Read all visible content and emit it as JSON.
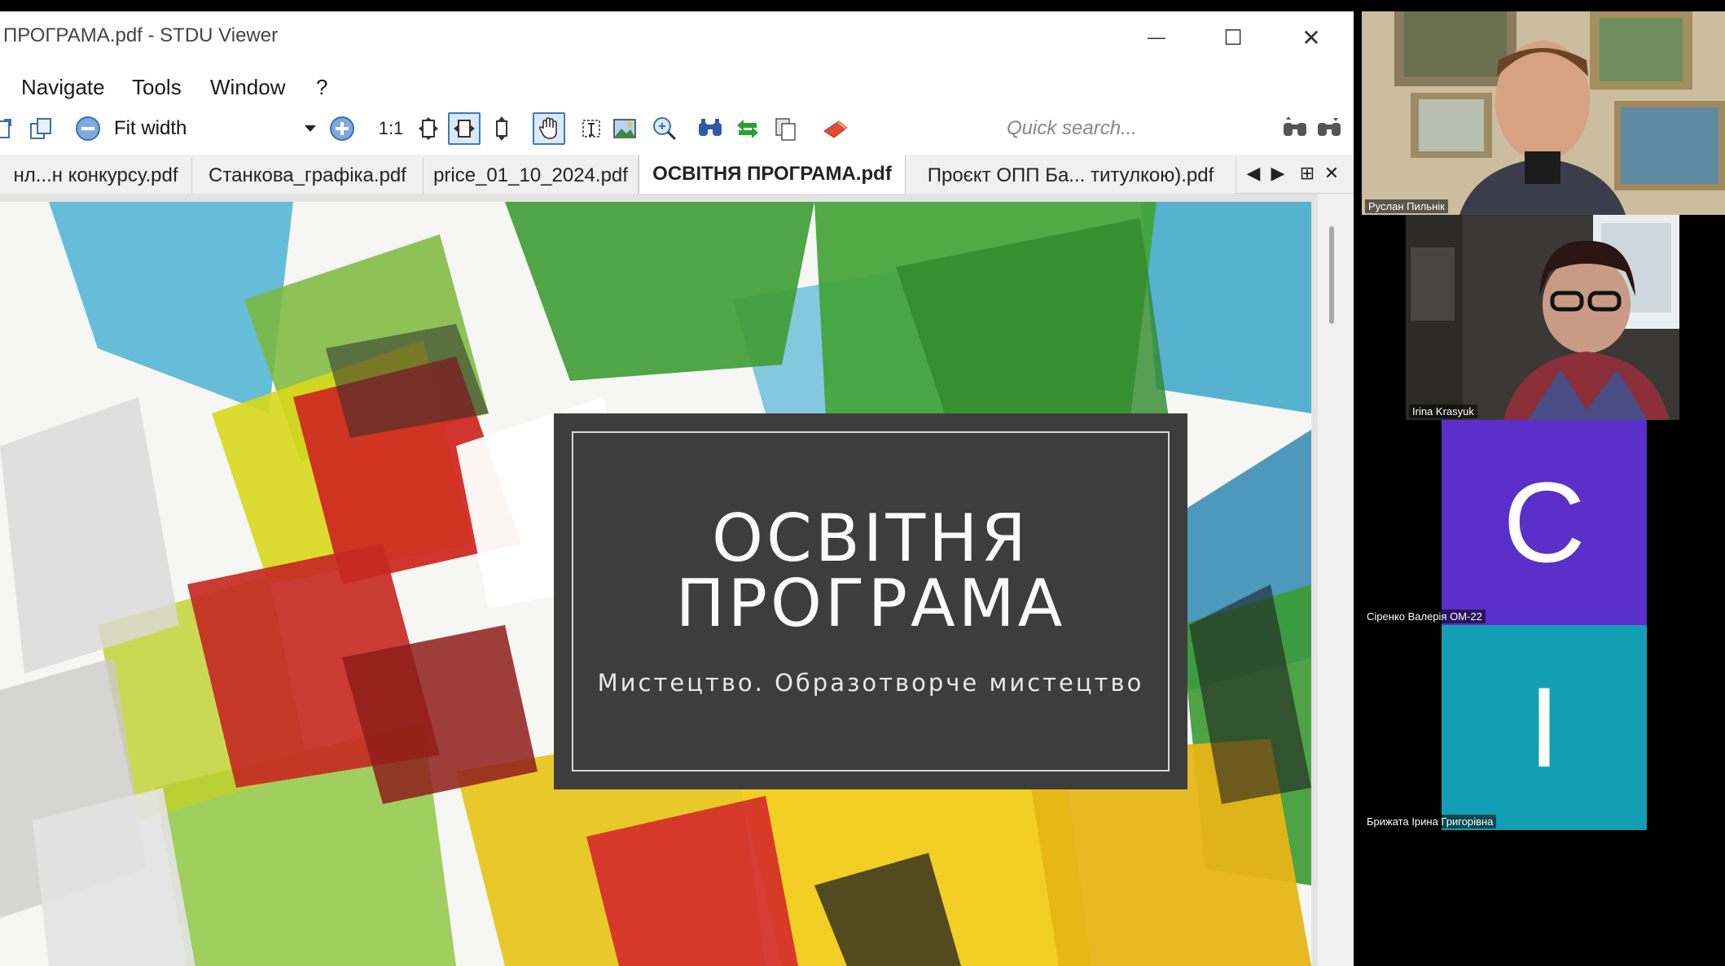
{
  "window": {
    "title": "ПРОГРАМА.pdf - STDU Viewer",
    "minimize": "—",
    "maximize": "☐",
    "close": "✕"
  },
  "menu": {
    "items": [
      "Navigate",
      "Tools",
      "Window",
      "?"
    ]
  },
  "toolbar": {
    "zoom_value": "Fit width",
    "actual_size_label": "1:1",
    "search_placeholder": "Quick search..."
  },
  "tabs": [
    {
      "label": "нл...н конкурсу.pdf",
      "active": false
    },
    {
      "label": "Станкова_графіка.pdf",
      "active": false
    },
    {
      "label": "price_01_10_2024.pdf",
      "active": false
    },
    {
      "label": "ОСВІТНЯ ПРОГРАМА.pdf",
      "active": true
    },
    {
      "label": "Проєкт ОПП Ба... титулкою).pdf",
      "active": false
    }
  ],
  "tab_controls": {
    "prev": "◀",
    "next": "▶",
    "grid": "⊞",
    "close": "✕"
  },
  "slide": {
    "title_line1": "ОСВІТНЯ",
    "title_line2": "ПРОГРАМА",
    "subtitle": "Мистецтво. Образотворче мистецтво"
  },
  "participants": [
    {
      "name": "Руслан Пильнік",
      "type": "video"
    },
    {
      "name": "Irina  Krasyuk",
      "type": "video"
    },
    {
      "name": "Сіренко Валерія ОМ-22",
      "type": "avatar",
      "letter": "С",
      "color": "#5b2fc9"
    },
    {
      "name": "Брижата Ірина Григорівна",
      "type": "avatar",
      "letter": "І",
      "color": "#129fb3"
    }
  ]
}
